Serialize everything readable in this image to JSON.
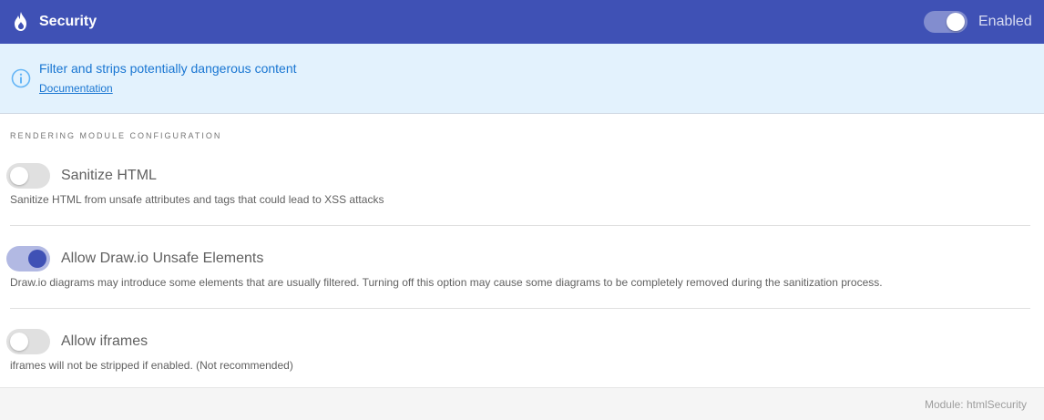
{
  "header": {
    "title": "Security",
    "icon": "flame-icon",
    "enabled_label": "Enabled",
    "enabled": true,
    "color": "#3f51b5"
  },
  "info": {
    "icon": "info-icon",
    "text": "Filter and strips potentially dangerous content",
    "link_label": "Documentation",
    "background": "#e3f2fd",
    "text_color": "#1976d2"
  },
  "section": {
    "heading": "RENDERING MODULE CONFIGURATION"
  },
  "options": [
    {
      "label": "Sanitize HTML",
      "description": "Sanitize HTML from unsafe attributes and tags that could lead to XSS attacks",
      "enabled": false
    },
    {
      "label": "Allow Draw.io Unsafe Elements",
      "description": "Draw.io diagrams may introduce some elements that are usually filtered. Turning off this option may cause some diagrams to be completely removed during the sanitization process.",
      "enabled": true
    },
    {
      "label": "Allow iframes",
      "description": "iframes will not be stripped if enabled. (Not recommended)",
      "enabled": false
    }
  ],
  "footer": {
    "module_label": "Module: htmlSecurity"
  }
}
